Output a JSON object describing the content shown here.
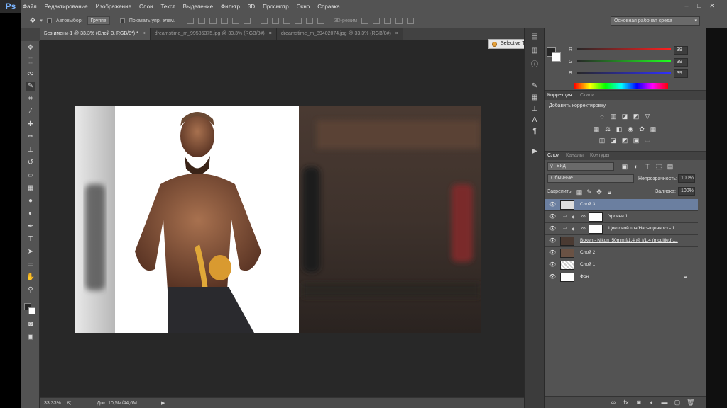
{
  "app": {
    "logo": "Ps"
  },
  "menu": [
    "Файл",
    "Редактирование",
    "Изображение",
    "Слои",
    "Текст",
    "Выделение",
    "Фильтр",
    "3D",
    "Просмотр",
    "Окно",
    "Справка"
  ],
  "options": {
    "autoselect_label": "Автовыбор:",
    "autoselect_value": "Группа",
    "show_controls_label": "Показать упр. элем.",
    "mode3d_label": "3D-режим",
    "workspace": "Основная рабочая среда"
  },
  "tabs": [
    {
      "label": "Без имени-1 @ 33,3% (Слой 3, RGB/8*) *"
    },
    {
      "label": "dreamstime_m_99586375.jpg @ 33,3% (RGB/8#)"
    },
    {
      "label": "dreamstime_m_89402074.jpg @ 33,3% (RGB/8#)"
    }
  ],
  "status": {
    "zoom": "33,33%",
    "doc": "Док: 10,5M/44,6M"
  },
  "selective_tool": {
    "title": "Selective Tool"
  },
  "color_panel": {
    "channels": [
      {
        "label": "R",
        "value": "39"
      },
      {
        "label": "G",
        "value": "39"
      },
      {
        "label": "B",
        "value": "39"
      }
    ]
  },
  "adjustments": {
    "tab_active": "Коррекция",
    "tab_other": "Стили",
    "heading": "Добавить корректировку"
  },
  "layers_panel": {
    "tabs": [
      "Слои",
      "Каналы",
      "Контуры"
    ],
    "filter": "Вид",
    "blend_mode": "Обычные",
    "opacity_label": "Непрозрачность:",
    "opacity_value": "100%",
    "lock_label": "Закрепить:",
    "fill_label": "Заливка:",
    "fill_value": "100%",
    "layers": [
      {
        "name": "Слой 3",
        "selected": true
      },
      {
        "name": "Уровни 1"
      },
      {
        "name": "Цветовой тон/Насыщенность 1"
      },
      {
        "name": "Bokeh - Nikon_50mm f/1.4 @ f/1.4 (modified)...."
      },
      {
        "name": "Слой 2"
      },
      {
        "name": "Слой 1"
      },
      {
        "name": "Фон"
      }
    ]
  },
  "colors": {
    "accent": "#6b7fa0",
    "ui_bg": "#535353",
    "canvas_bg": "#282828"
  }
}
